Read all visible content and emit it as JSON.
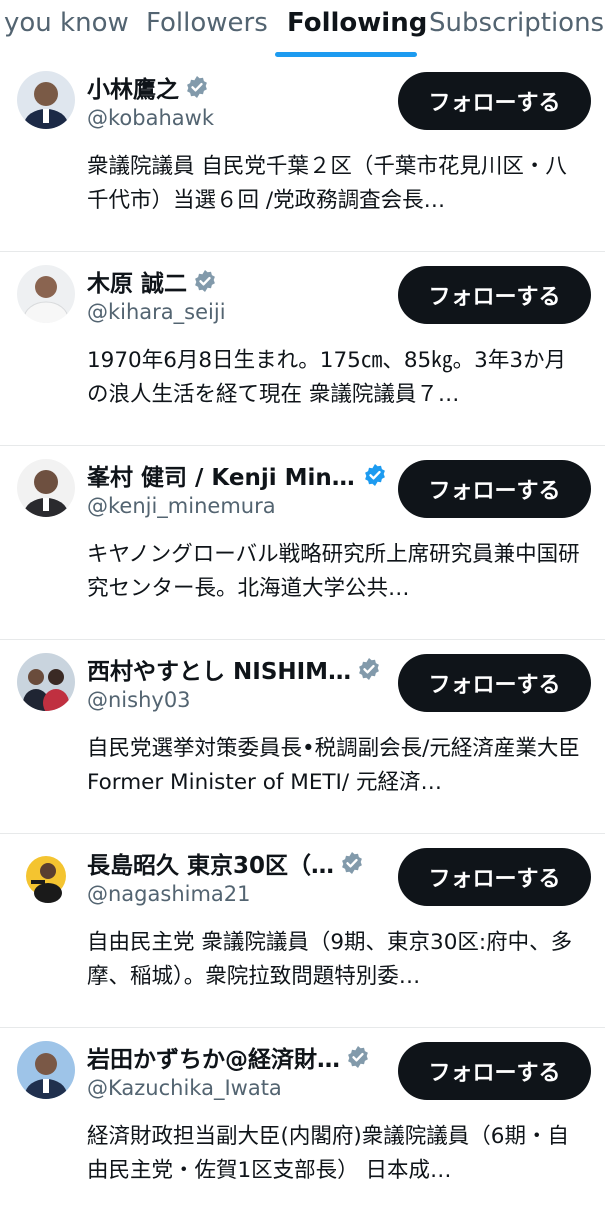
{
  "tabs": [
    "you know",
    "Followers",
    "Following",
    "Subscriptions"
  ],
  "active_tab": "Following",
  "follow_label": "フォローする",
  "colors": {
    "accent": "#1d9bf0",
    "verified": "#829aab",
    "button": "#0f1419"
  },
  "accounts": [
    {
      "name": "小林鷹之",
      "handle": "@kobahawk",
      "verified_icon": "verified-badge-icon",
      "bio": "衆議院議員 自民党千葉２区（千葉市花見川区・八千代市）当選６回 /党政務調査会長…"
    },
    {
      "name": "木原 誠二",
      "handle": "@kihara_seiji",
      "verified_icon": "verified-badge-icon",
      "bio": "1970年6月8日生まれ。175㎝、85㎏。3年3か月の浪人生活を経て現在 衆議院議員７…"
    },
    {
      "name": "峯村 健司 / Kenji Mine…",
      "handle": "@kenji_minemura",
      "verified_icon": "verified-badge-icon",
      "bio": "キヤノングローバル戦略研究所上席研究員兼中国研究センター長。北海道大学公共…"
    },
    {
      "name": "西村やすとし NISHIM…",
      "handle": "@nishy03",
      "verified_icon": "verified-badge-icon",
      "bio": "自民党選挙対策委員長•税調副会長/元経済産業大臣 Former Minister of METI/ 元経済…"
    },
    {
      "name": "長島昭久 東京30区（…",
      "handle": "@nagashima21",
      "verified_icon": "verified-badge-icon",
      "bio": "自由民主党 衆議院議員（9期、東京30区:府中、多摩、稲城）。衆院拉致問題特別委…"
    },
    {
      "name": "岩田かずちか@経済財…",
      "handle": "@Kazuchika_Iwata",
      "verified_icon": "verified-badge-icon",
      "bio": "経済財政担当副大臣(内閣府)衆議院議員（6期・自由民主党・佐賀1区支部長） 日本成…"
    }
  ]
}
